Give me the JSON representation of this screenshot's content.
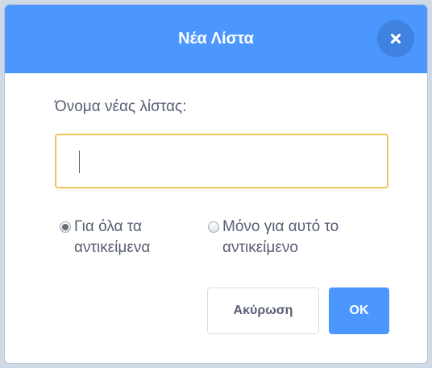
{
  "dialog": {
    "title": "Νέα Λίστα",
    "close_icon": "close-x-icon",
    "accent_color": "#4c97ff",
    "input_focus_color": "#f0c35b"
  },
  "form": {
    "label": "Όνομα νέας λίστας:",
    "input_value": "",
    "options": [
      {
        "label": "Για όλα τα αντικείμενα",
        "selected": true
      },
      {
        "label": "Μόνο για αυτό το αντικείμενο",
        "selected": false
      }
    ]
  },
  "buttons": {
    "cancel_label": "Ακύρωση",
    "ok_label": "OK"
  }
}
